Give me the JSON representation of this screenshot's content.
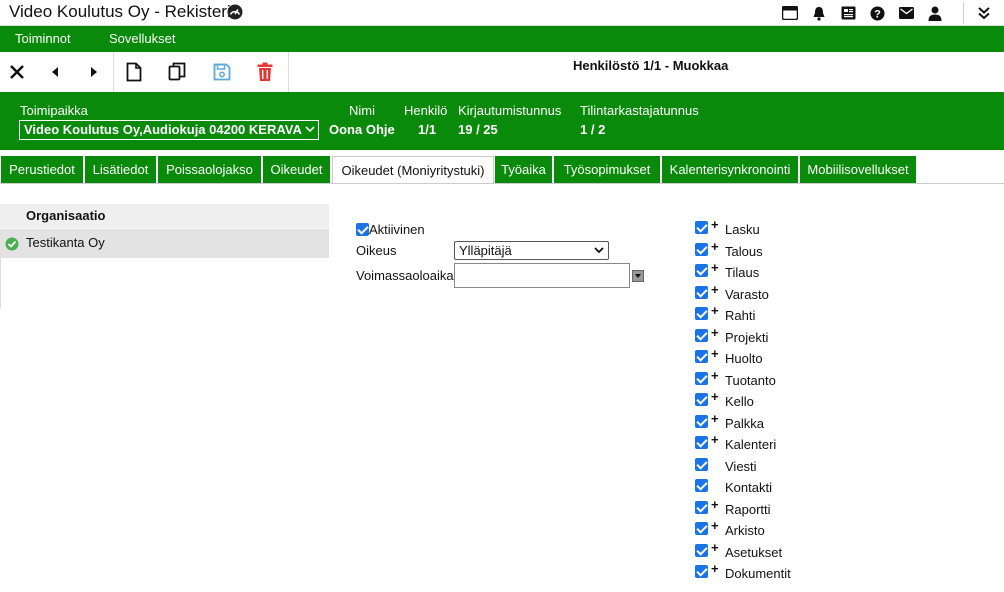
{
  "app": {
    "title": "Video Koulutus Oy - Rekisterit"
  },
  "top_icons": [
    "window-icon",
    "bell-icon",
    "news-icon",
    "help-icon",
    "mail-icon",
    "user-icon",
    "double-chevron-down-icon"
  ],
  "menu": {
    "items": [
      "Toiminnot",
      "Sovellukset"
    ]
  },
  "toolbar": {
    "record_title": "Henkilöstö 1/1 - Muokkaa"
  },
  "info": {
    "location_label": "Toimipaikka",
    "location_value": "Video Koulutus Oy,Audiokuja 04200 KERAVA",
    "name_label": "Nimi",
    "name_value": "Oona Ohje",
    "person_label": "Henkilö",
    "person_value": "1/1",
    "login_label": "Kirjautumistunnus",
    "login_value": "19 / 25",
    "auditor_label": "Tilintarkastajatunnus",
    "auditor_value": "1 / 2"
  },
  "tabs": [
    "Perustiedot",
    "Lisätiedot",
    "Poissaolojakso",
    "Oikeudet",
    "Oikeudet (Moniyritystuki)",
    "Työaika",
    "Työsopimukset",
    "Kalenterisynkronointi",
    "Mobiilisovellukset"
  ],
  "active_tab": "Oikeudet (Moniyritystuki)",
  "org": {
    "header": "Organisaatio",
    "rows": [
      "Testikanta Oy"
    ]
  },
  "form": {
    "active_label": "Aktiivinen",
    "active_checked": true,
    "right_label": "Oikeus",
    "right_value": "Ylläpitäjä",
    "validity_label": "Voimassaoloaika",
    "validity_value": ""
  },
  "modules": [
    {
      "name": "Lasku",
      "checked": true,
      "plus": true
    },
    {
      "name": "Talous",
      "checked": true,
      "plus": true
    },
    {
      "name": "Tilaus",
      "checked": true,
      "plus": true
    },
    {
      "name": "Varasto",
      "checked": true,
      "plus": true
    },
    {
      "name": "Rahti",
      "checked": true,
      "plus": true
    },
    {
      "name": "Projekti",
      "checked": true,
      "plus": true
    },
    {
      "name": "Huolto",
      "checked": true,
      "plus": true
    },
    {
      "name": "Tuotanto",
      "checked": true,
      "plus": true
    },
    {
      "name": "Kello",
      "checked": true,
      "plus": true
    },
    {
      "name": "Palkka",
      "checked": true,
      "plus": true
    },
    {
      "name": "Kalenteri",
      "checked": true,
      "plus": true
    },
    {
      "name": "Viesti",
      "checked": true,
      "plus": false
    },
    {
      "name": "Kontakti",
      "checked": true,
      "plus": false
    },
    {
      "name": "Raportti",
      "checked": true,
      "plus": true
    },
    {
      "name": "Arkisto",
      "checked": true,
      "plus": true
    },
    {
      "name": "Asetukset",
      "checked": true,
      "plus": true
    },
    {
      "name": "Dokumentit",
      "checked": true,
      "plus": true
    }
  ],
  "colors": {
    "green": "#0a8a0a",
    "check_blue": "#1a73e8",
    "delete_red": "#e53935",
    "save_blue": "#5aa8e0"
  }
}
